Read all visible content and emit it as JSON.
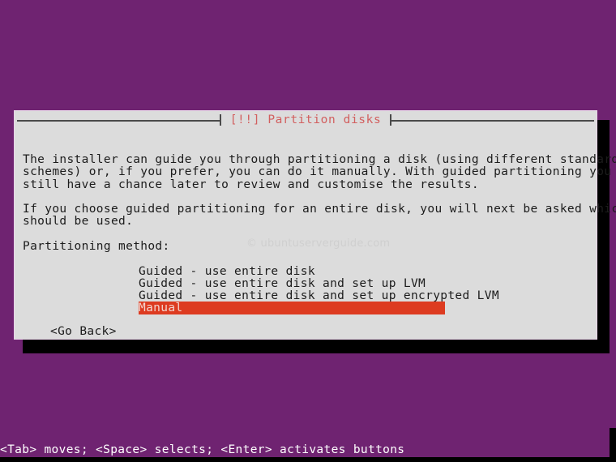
{
  "screen": {
    "background_color": "#6f2371",
    "text_color": "#ffffff"
  },
  "dialog": {
    "title": "[!!] Partition disks",
    "title_color": "#d25f5f",
    "background_color": "#dcdcdc",
    "border_color": "#e8d2e8",
    "paragraphs": {
      "intro_line1": "The installer can guide you through partitioning a disk (using different standard",
      "intro_line2": "schemes) or, if you prefer, you can do it manually. With guided partitioning you will",
      "intro_line3": "still have a chance later to review and customise the results.",
      "guided_line1": "If you choose guided partitioning for an entire disk, you will next be asked which disk",
      "guided_line2": "should be used."
    },
    "method_label": "Partitioning method:",
    "menu": {
      "items": [
        {
          "label": "Guided - use entire disk",
          "selected": false
        },
        {
          "label": "Guided - use entire disk and set up LVM",
          "selected": false
        },
        {
          "label": "Guided - use entire disk and set up encrypted LVM",
          "selected": false
        },
        {
          "label": "Manual",
          "selected": true
        }
      ],
      "selection_bg": "#dd3b20",
      "selection_fg": "#f2d5cf"
    },
    "go_back_button": "<Go Back>"
  },
  "watermark": {
    "text": "© ubuntuserverguide.com"
  },
  "statusbar": {
    "text": "<Tab> moves; <Space> selects; <Enter> activates buttons"
  }
}
